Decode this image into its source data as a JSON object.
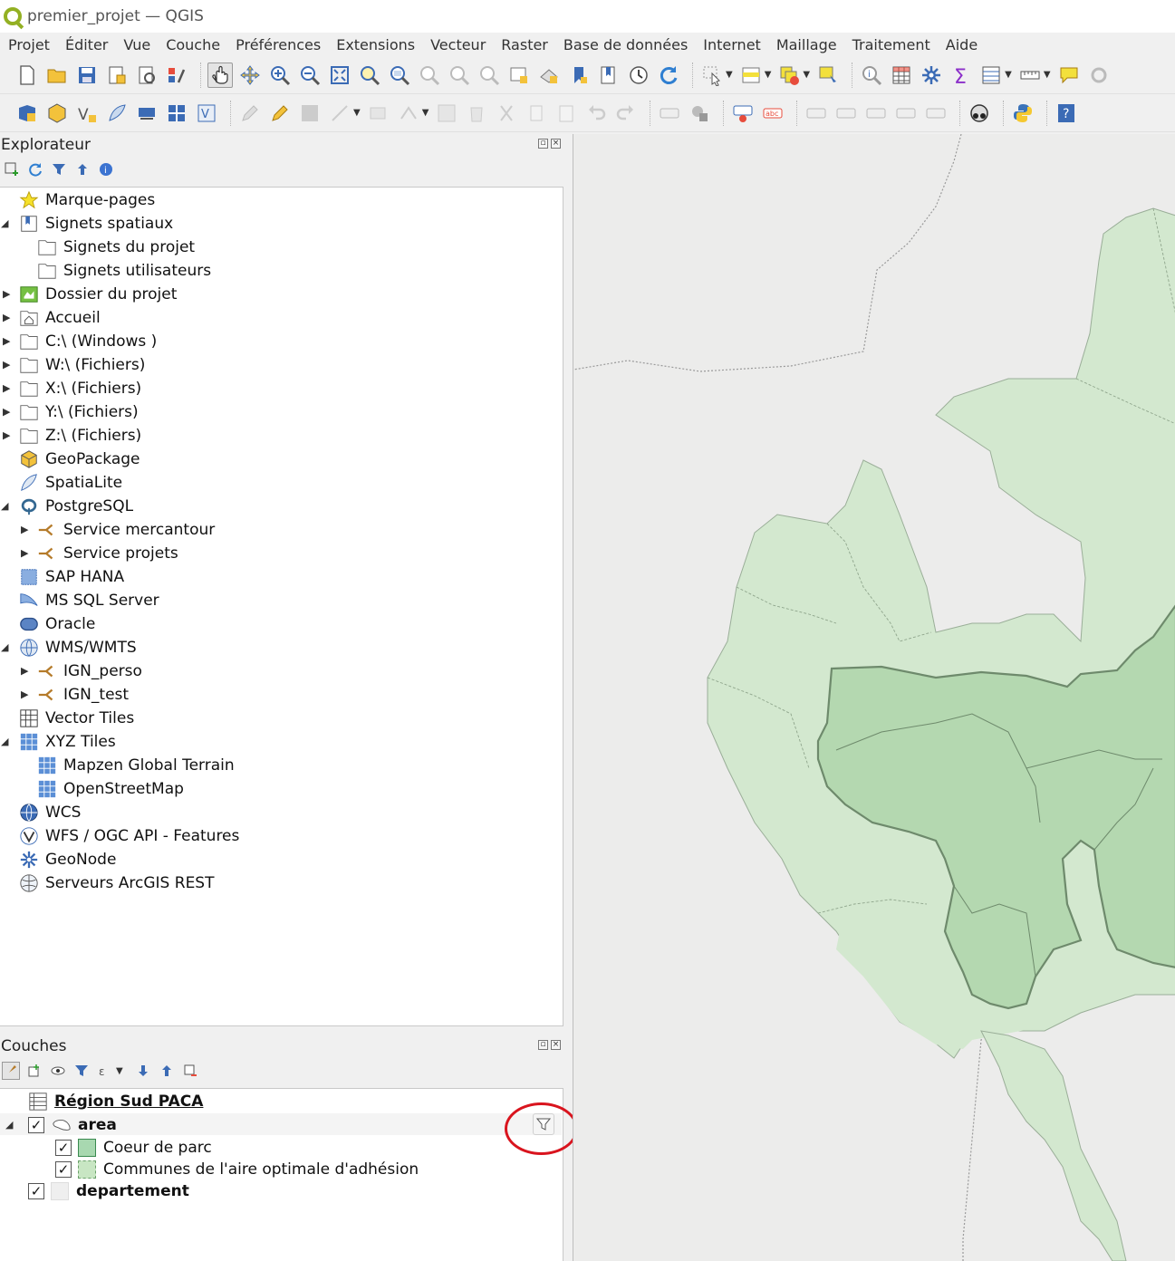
{
  "window": {
    "title": "premier_projet — QGIS"
  },
  "menu": [
    "Projet",
    "Éditer",
    "Vue",
    "Couche",
    "Préférences",
    "Extensions",
    "Vecteur",
    "Raster",
    "Base de données",
    "Internet",
    "Maillage",
    "Traitement",
    "Aide"
  ],
  "explorer": {
    "title": "Explorateur",
    "items": [
      {
        "label": "Marque-pages",
        "icon": "star-icon"
      },
      {
        "label": "Signets spatiaux",
        "icon": "bookmark-icon"
      },
      {
        "label": "Signets du projet",
        "icon": "folder-icon"
      },
      {
        "label": "Signets utilisateurs",
        "icon": "folder-icon"
      },
      {
        "label": "Dossier du projet",
        "icon": "project-folder-icon"
      },
      {
        "label": "Accueil",
        "icon": "home-folder-icon"
      },
      {
        "label": "C:\\ (Windows )",
        "icon": "folder-icon"
      },
      {
        "label": "W:\\ (Fichiers)",
        "icon": "folder-icon"
      },
      {
        "label": "X:\\ (Fichiers)",
        "icon": "folder-icon"
      },
      {
        "label": "Y:\\ (Fichiers)",
        "icon": "folder-icon"
      },
      {
        "label": "Z:\\ (Fichiers)",
        "icon": "folder-icon"
      },
      {
        "label": "GeoPackage",
        "icon": "geopackage-icon"
      },
      {
        "label": "SpatiaLite",
        "icon": "spatialite-icon"
      },
      {
        "label": "PostgreSQL",
        "icon": "postgresql-icon"
      },
      {
        "label": "Service mercantour",
        "icon": "connection-icon"
      },
      {
        "label": "Service projets",
        "icon": "connection-icon"
      },
      {
        "label": "SAP HANA",
        "icon": "sap-hana-icon"
      },
      {
        "label": "MS SQL Server",
        "icon": "mssql-icon"
      },
      {
        "label": "Oracle",
        "icon": "oracle-icon"
      },
      {
        "label": "WMS/WMTS",
        "icon": "wms-icon"
      },
      {
        "label": "IGN_perso",
        "icon": "connection-icon"
      },
      {
        "label": "IGN_test",
        "icon": "connection-icon"
      },
      {
        "label": "Vector Tiles",
        "icon": "vector-tiles-icon"
      },
      {
        "label": "XYZ Tiles",
        "icon": "xyz-tiles-icon"
      },
      {
        "label": "Mapzen Global Terrain",
        "icon": "xyz-tiles-icon"
      },
      {
        "label": "OpenStreetMap",
        "icon": "xyz-tiles-icon"
      },
      {
        "label": "WCS",
        "icon": "wcs-icon"
      },
      {
        "label": "WFS / OGC API - Features",
        "icon": "wfs-icon"
      },
      {
        "label": "GeoNode",
        "icon": "geonode-icon"
      },
      {
        "label": "Serveurs ArcGIS REST",
        "icon": "arcgis-icon"
      }
    ]
  },
  "layers": {
    "title": "Couches",
    "group": "Région Sud PACA",
    "items": [
      {
        "label": "area"
      },
      {
        "label": "Coeur de parc"
      },
      {
        "label": "Communes de l'aire optimale d'adhésion"
      },
      {
        "label": "departement"
      }
    ],
    "checkmark": "✓"
  },
  "colors": {
    "coeur_fill": "#b4d8b0",
    "communes_fill": "#d3e8cf",
    "map_background": "#ececeb",
    "highlight_circle": "#d9141e"
  }
}
